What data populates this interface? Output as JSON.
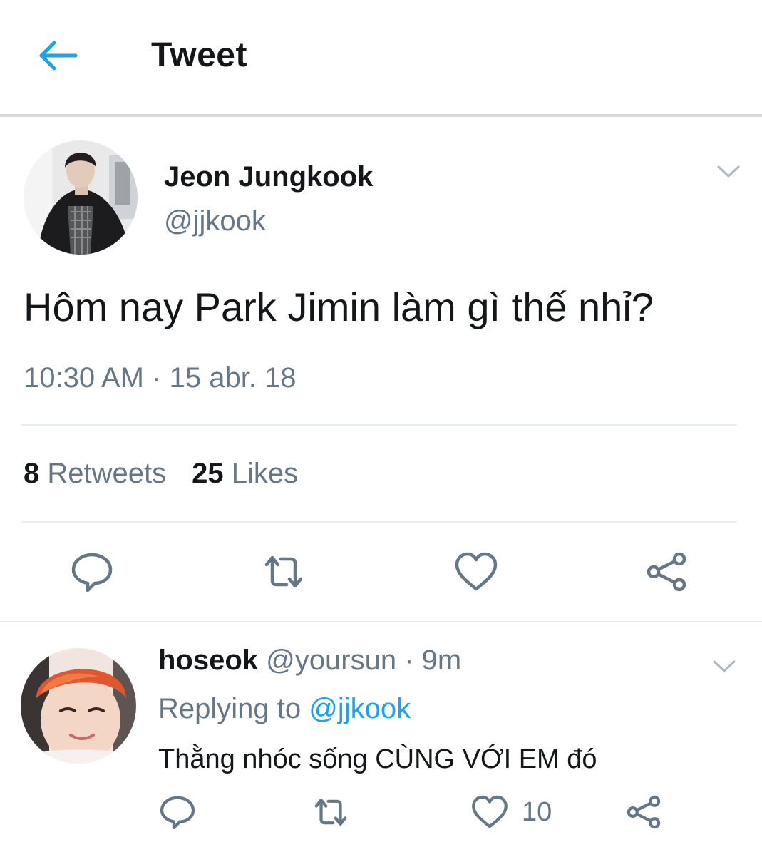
{
  "header": {
    "title": "Tweet",
    "back_icon": "back-arrow-icon",
    "accent": "#1da1f2"
  },
  "tweet": {
    "author_name": "Jeon Jungkook",
    "author_handle": "@jjkook",
    "text": "Hôm nay Park Jimin làm gì thế nhỉ?",
    "time": "10:30 AM",
    "separator": "·",
    "date": "15 abr. 18",
    "retweets_count": "8",
    "retweets_label": "Retweets",
    "likes_count": "25",
    "likes_label": "Likes",
    "actions": [
      "reply-icon",
      "retweet-icon",
      "like-icon",
      "share-icon"
    ]
  },
  "reply": {
    "author_name": "hoseok",
    "author_handle": "@yoursun",
    "separator": "·",
    "age": "9m",
    "replying_label": "Replying to",
    "replying_handle": "@jjkook",
    "text": "Thằng nhóc sống CÙNG VỚI EM đó",
    "like_count": "10",
    "actions": [
      "reply-icon",
      "retweet-icon",
      "like-icon",
      "share-icon"
    ]
  },
  "colors": {
    "text": "#14171a",
    "secondary": "#657786",
    "link": "#1da1f2",
    "divider": "#e6ecf0"
  }
}
